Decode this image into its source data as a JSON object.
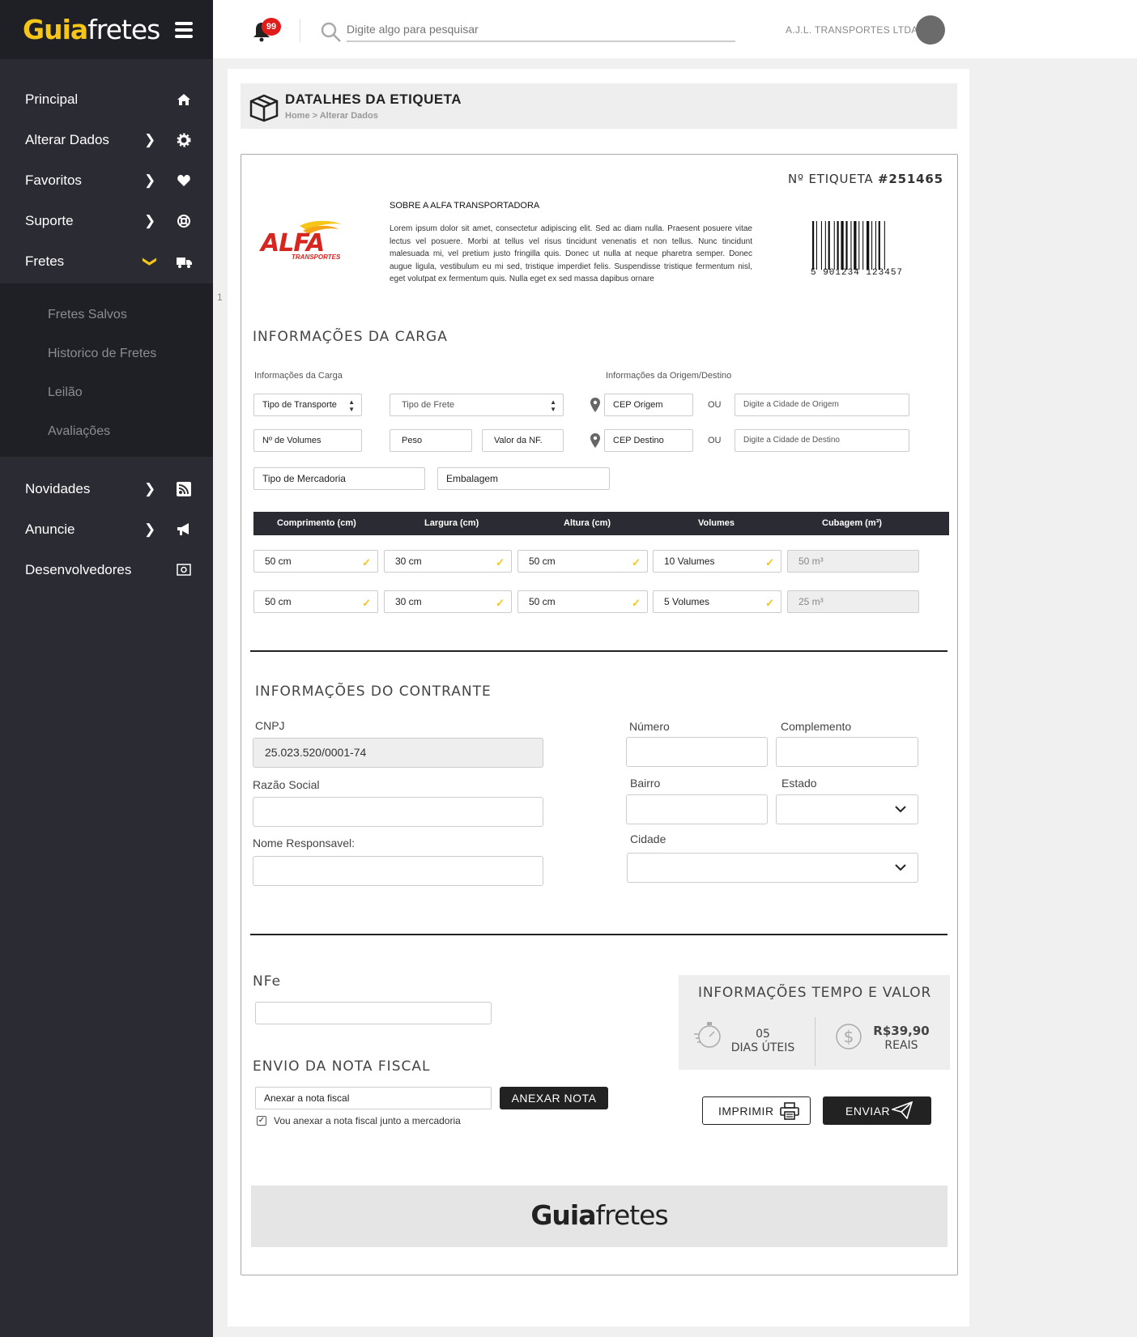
{
  "brand": {
    "name_bold": "Guia",
    "name_light": "fretes"
  },
  "sidebar": {
    "items": [
      {
        "label": "Principal",
        "icon": "home-icon"
      },
      {
        "label": "Alterar Dados",
        "icon": "gear-icon"
      },
      {
        "label": "Favoritos",
        "icon": "heart-icon"
      },
      {
        "label": "Suporte",
        "icon": "lifebuoy-icon"
      },
      {
        "label": "Fretes",
        "icon": "truck-icon"
      },
      {
        "label": "Novidades",
        "icon": "rss-icon"
      },
      {
        "label": "Anuncie",
        "icon": "megaphone-icon"
      },
      {
        "label": "Desenvolvedores",
        "icon": "code-icon"
      }
    ],
    "sub_items": [
      "Fretes Salvos",
      "Historico de Fretes",
      "Leilão",
      "Avaliações"
    ]
  },
  "topbar": {
    "notifications": "99",
    "search_placeholder": "Digite algo para pesquisar",
    "company": "A.J.L. TRANSPORTES LTDA."
  },
  "page": {
    "title": "DATALHES DA ETIQUETA",
    "breadcrumb": "Home > Alterar Dados"
  },
  "label_card": {
    "number_label": "Nº ETIQUETA",
    "number_value": "#251465",
    "about_title": "SOBRE A ALFA TRANSPORTADORA",
    "about_text": "Lorem ipsum dolor sit amet, consectetur adipiscing elit. Sed ac diam nulla. Praesent posuere vitae lectus vel posuere. Morbi at tellus vel risus tincidunt venenatis et non tellus. Nunc tincidunt malesuada mi, vel pretium justo fringilla quis. Donec ut nulla at neque pharetra semper. Donec augue ligula, vestibulum eu mi sed, tristique imperdiet felis. Suspendisse tristique fermentum nisl, eget volutpat ex fermentum quis. Nulla eget ex sed massa dapibus ornare",
    "carrier_logo_main": "ALFA",
    "carrier_logo_sub": "TRANSPORTES",
    "barcode_digits": "5 901234 123457"
  },
  "cargo": {
    "title": "INFORMAÇÕES DA CARGA",
    "left_label": "Informações da Carga",
    "right_label": "Informações da Origem/Destino",
    "tipo_transporte": "Tipo de Transporte",
    "tipo_frete": "Tipo de Frete",
    "volumes": "Nº de Volumes",
    "peso": "Peso",
    "valor_nf": "Valor da NF.",
    "tipo_mercadoria": "Tipo de  Mercadoria",
    "embalagem": "Embalagem",
    "cep_origem": "CEP Origem",
    "cep_destino": "CEP Destino",
    "ou": "OU",
    "cidade_origem": "Digite a Cidade de Origem",
    "cidade_destino": "Digite a Cidade de Destino"
  },
  "dimensions": {
    "headers": [
      "Comprimento (cm)",
      "Largura (cm)",
      "Altura (cm)",
      "Volumes",
      "Cubagem (m³)"
    ],
    "rows": [
      [
        "50 cm",
        "30 cm",
        "50 cm",
        "10 Valumes",
        "50 m³"
      ],
      [
        "50 cm",
        "30 cm",
        "50 cm",
        "5  Volumes",
        "25 m³"
      ]
    ]
  },
  "contractor": {
    "title": "INFORMAÇÕES DO CONTRANTE",
    "cnpj_label": "CNPJ",
    "cnpj_value": "25.023.520/0001-74",
    "razao_label": "Razão Social",
    "responsavel_label": "Nome Responsavel:",
    "numero_label": "Número",
    "complemento_label": "Complemento",
    "bairro_label": "Bairro",
    "estado_label": "Estado",
    "cidade_label": "Cidade"
  },
  "nfe": {
    "title": "NFe",
    "envio_title": "ENVIO DA NOTA FISCAL",
    "anexar_placeholder": "Anexar a nota fiscal",
    "anexar_button": "ANEXAR NOTA",
    "checkbox_label": "Vou anexar a nota fiscal junto a mercadoria",
    "checkbox_checked": true
  },
  "tempo_valor": {
    "title": "INFORMAÇÕES TEMPO E VALOR",
    "days_value": "05",
    "days_label": "DIAS ÚTEIS",
    "price_value": "R$39,90",
    "price_label": "REAIS"
  },
  "actions": {
    "print": "IMPRIMIR",
    "send": "ENVIAR"
  },
  "side_marker": "1"
}
